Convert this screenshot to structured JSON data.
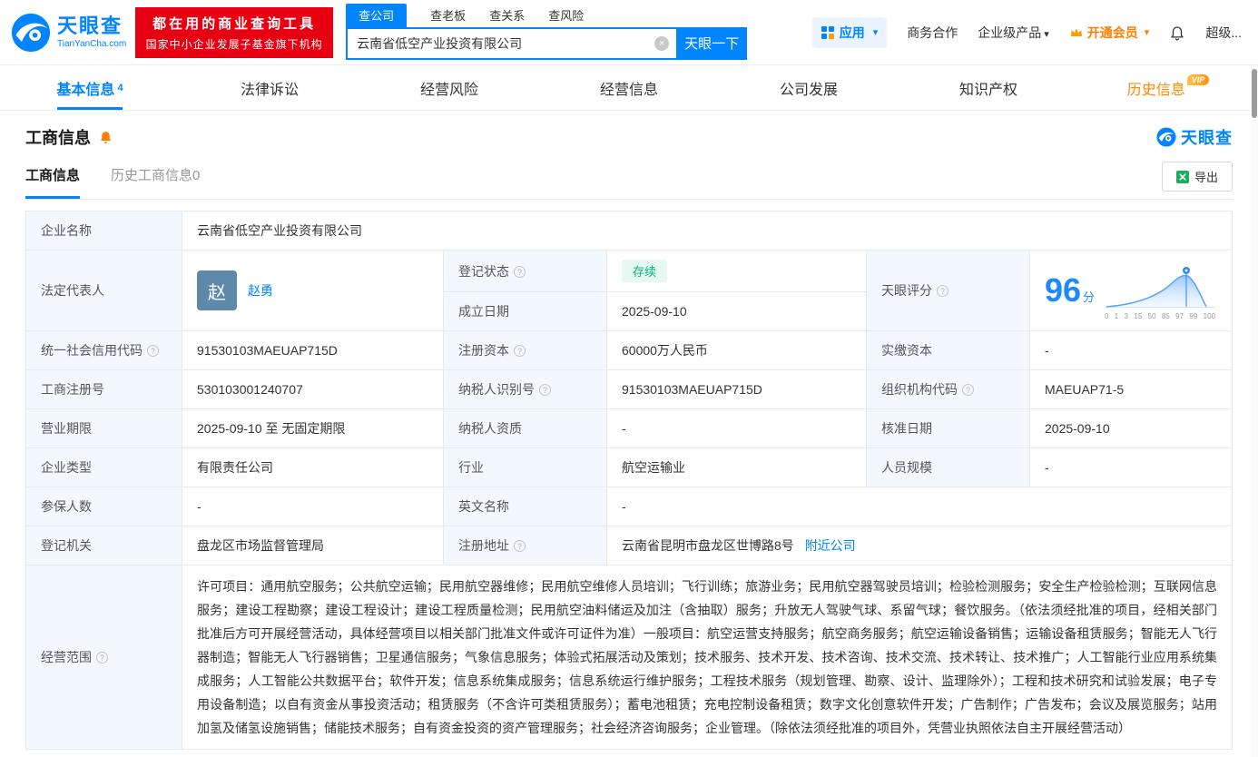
{
  "brand": {
    "name": "天眼查",
    "domain": "TianYanCha.com",
    "banner_line1": "都在用的商业查询工具",
    "banner_line2": "国家中小企业发展子基金旗下机构"
  },
  "search": {
    "tabs": [
      {
        "label": "查公司"
      },
      {
        "label": "查老板"
      },
      {
        "label": "查关系"
      },
      {
        "label": "查风险"
      }
    ],
    "value": "云南省低空产业投资有限公司",
    "button_label": "天眼一下"
  },
  "top_menu": {
    "apps_label": "应用",
    "items": [
      "商务合作",
      "企业级产品",
      "开通会员",
      "超级..."
    ]
  },
  "nav": {
    "tabs": [
      {
        "label": "基本信息",
        "badge": "4"
      },
      {
        "label": "法律诉讼"
      },
      {
        "label": "经营风险"
      },
      {
        "label": "经营信息"
      },
      {
        "label": "公司发展"
      },
      {
        "label": "知识产权"
      },
      {
        "label": "历史信息",
        "vip": "VIP"
      }
    ]
  },
  "section": {
    "title": "工商信息",
    "watermark": "天眼查",
    "sub_tabs": [
      {
        "label": "工商信息"
      },
      {
        "label": "历史工商信息0"
      }
    ],
    "export_label": "导出"
  },
  "table": {
    "labels": {
      "company_name": "企业名称",
      "legal_rep": "法定代表人",
      "reg_status": "登记状态",
      "establish_date": "成立日期",
      "score": "天眼评分",
      "credit_code": "统一社会信用代码",
      "reg_capital": "注册资本",
      "paid_capital": "实缴资本",
      "reg_number": "工商注册号",
      "taxpayer_id": "纳税人识别号",
      "org_code": "组织机构代码",
      "business_term": "营业期限",
      "taxpayer_quality": "纳税人资质",
      "approval_date": "核准日期",
      "company_type": "企业类型",
      "industry": "行业",
      "staff_size": "人员规模",
      "insured_count": "参保人数",
      "english_name": "英文名称",
      "reg_authority": "登记机关",
      "reg_address": "注册地址",
      "business_scope": "经营范围"
    },
    "values": {
      "company_name": "云南省低空产业投资有限公司",
      "legal_rep_avatar": "赵",
      "legal_rep": "赵勇",
      "reg_status": "存续",
      "establish_date": "2025-09-10",
      "score_value": "96",
      "score_unit": "分",
      "score_ticks": [
        "0",
        "1",
        "3",
        "15",
        "50",
        "85",
        "97",
        "99",
        "100"
      ],
      "credit_code": "91530103MAEUAP715D",
      "reg_capital": "60000万人民币",
      "paid_capital": "-",
      "reg_number": "530103001240707",
      "taxpayer_id": "91530103MAEUAP715D",
      "org_code": "MAEUAP71-5",
      "business_term": "2025-09-10 至 无固定期限",
      "taxpayer_quality": "-",
      "approval_date": "2025-09-10",
      "company_type": "有限责任公司",
      "industry": "航空运输业",
      "staff_size": "-",
      "insured_count": "-",
      "english_name": "-",
      "reg_authority": "盘龙区市场监督管理局",
      "reg_address": "云南省昆明市盘龙区世博路8号",
      "reg_address_link": "附近公司",
      "business_scope": "许可项目：通用航空服务；公共航空运输；民用航空器维修；民用航空维修人员培训；飞行训练；旅游业务；民用航空器驾驶员培训；检验检测服务；安全生产检验检测；互联网信息服务；建设工程勘察；建设工程设计；建设工程质量检测；民用航空油料储运及加注（含抽取）服务；升放无人驾驶气球、系留气球；餐饮服务。（依法须经批准的项目，经相关部门批准后方可开展经营活动，具体经营项目以相关部门批准文件或许可证件为准）一般项目：航空运营支持服务；航空商务服务；航空运输设备销售；运输设备租赁服务；智能无人飞行器制造；智能无人飞行器销售；卫星通信服务；气象信息服务；体验式拓展活动及策划；技术服务、技术开发、技术咨询、技术交流、技术转让、技术推广；人工智能行业应用系统集成服务；人工智能公共数据平台；软件开发；信息系统集成服务；信息系统运行维护服务；工程技术服务（规划管理、勘察、设计、监理除外）；工程和技术研究和试验发展；电子专用设备制造；以自有资金从事投资活动；租赁服务（不含许可类租赁服务）；蓄电池租赁；充电控制设备租赁；数字文化创意软件开发；广告制作；广告发布；会议及展览服务；站用加氢及储氢设施销售；储能技术服务；自有资金投资的资产管理服务；社会经济咨询服务；企业管理。（除依法须经批准的项目外，凭营业执照依法自主开展经营活动）"
    }
  },
  "colors": {
    "brand_blue": "#0084ff",
    "banner_red": "#e60012",
    "vip_orange": "#ff8a00",
    "status_green": "#00b578",
    "label_bg": "#f2f8fe"
  }
}
